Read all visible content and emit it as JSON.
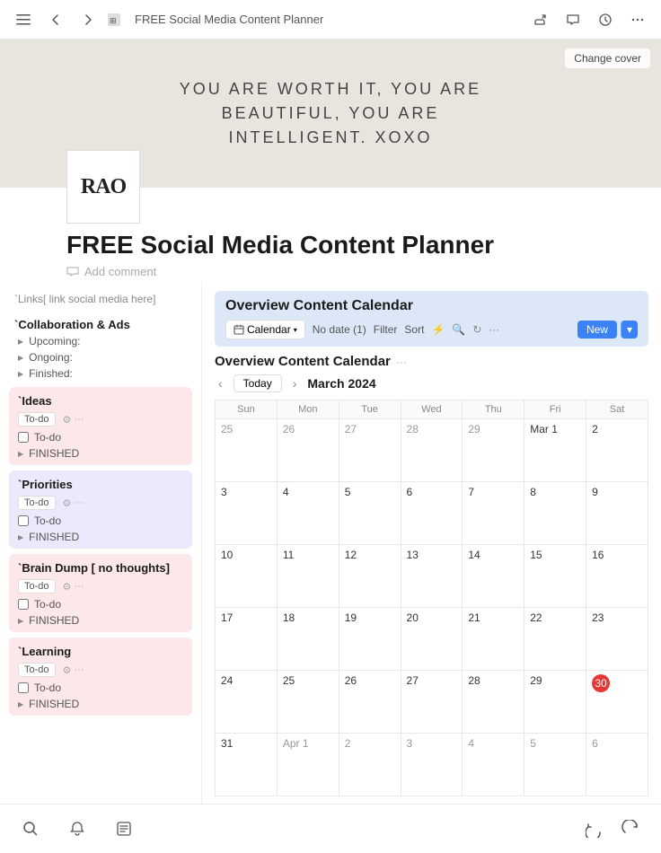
{
  "topbar": {
    "title": "FREE Social Media Content Planner",
    "back_icon": "←",
    "forward_icon": "→",
    "menu_icon": "☰",
    "dots_icon": "···"
  },
  "cover": {
    "text_line1": "YOU ARE WORTH IT, YOU ARE",
    "text_line2": "BEAUTIFUL, YOU ARE",
    "text_line3": "INTELLIGENT. XOXO",
    "logo_text": "RAO",
    "change_cover": "Change cover"
  },
  "page": {
    "title": "FREE Social Media Content Planner",
    "add_comment": "Add comment"
  },
  "sidebar": {
    "links_label": "`Links[ link social media here]",
    "sections": [
      {
        "label": "`Collaboration & Ads",
        "color": "white",
        "items": [
          "Upcoming:",
          "Ongoing:",
          "Finished:"
        ]
      },
      {
        "label": "`Ideas",
        "color": "red",
        "todo_label": "To-do",
        "todo_check": "To-do",
        "finished": "FINISHED"
      },
      {
        "label": "`Priorities",
        "color": "purple",
        "todo_label": "To-do",
        "todo_check": "To-do",
        "finished": "FINISHED"
      },
      {
        "label": "`Brain Dump [ no thoughts]",
        "color": "red",
        "todo_label": "To-do",
        "todo_check": "To-do",
        "finished": "FINISHED"
      },
      {
        "label": "`Learning",
        "color": "red",
        "todo_label": "To-do",
        "todo_check": "To-do",
        "finished": "FINISHED"
      }
    ]
  },
  "calendar": {
    "header_title": "Overview Content Calendar",
    "title": "Overview Content Calendar",
    "toolbar": {
      "view": "Calendar",
      "no_date": "No date (1)",
      "filter": "Filter",
      "sort": "Sort",
      "new_btn": "New"
    },
    "month": "March 2024",
    "today_btn": "Today",
    "days": [
      "Sun",
      "Mon",
      "Tue",
      "Wed",
      "Thu",
      "Fri",
      "Sat"
    ],
    "weeks": [
      [
        "25",
        "26",
        "27",
        "28",
        "29",
        "Mar 1",
        "2"
      ],
      [
        "3",
        "4",
        "5",
        "6",
        "7",
        "8",
        "9"
      ],
      [
        "10",
        "11",
        "12",
        "13",
        "14",
        "15",
        "16"
      ],
      [
        "17",
        "18",
        "19",
        "20",
        "21",
        "22",
        "23"
      ],
      [
        "24",
        "25",
        "26",
        "27",
        "28",
        "29",
        "30"
      ],
      [
        "31",
        "Apr 1",
        "2",
        "3",
        "4",
        "5",
        "6"
      ]
    ],
    "today_cell": [
      4,
      6
    ],
    "prev_month_cols_row0": [
      0,
      1,
      2,
      3,
      4
    ],
    "current_month_start_row0": 5
  },
  "bottombar": {
    "search_icon": "🔍",
    "bell_icon": "🔔",
    "edit_icon": "✏️",
    "back_icon": "↩",
    "forward_icon": "↪"
  }
}
